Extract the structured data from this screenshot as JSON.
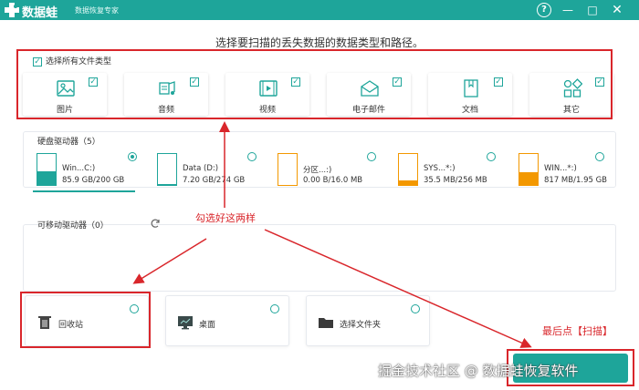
{
  "app": {
    "brand": "数据蛙",
    "subtitle": "数据恢复专家",
    "controls": {
      "help": "?",
      "minimize": "—",
      "maximize": "□",
      "close": "✕"
    }
  },
  "heading": "选择要扫描的丢失数据的数据类型和路径。",
  "select_all": {
    "label": "选择所有文件类型",
    "checked": true
  },
  "file_types": [
    {
      "label": "图片",
      "icon": "image-icon",
      "checked": true
    },
    {
      "label": "音频",
      "icon": "music-icon",
      "checked": true
    },
    {
      "label": "视频",
      "icon": "video-icon",
      "checked": true
    },
    {
      "label": "电子邮件",
      "icon": "email-icon",
      "checked": true
    },
    {
      "label": "文档",
      "icon": "document-icon",
      "checked": true
    },
    {
      "label": "其它",
      "icon": "other-icon",
      "checked": true
    }
  ],
  "hard_drives": {
    "title": "硬盘驱动器（5）",
    "items": [
      {
        "name": "Win...C:)",
        "size": "85.9 GB/200 GB",
        "used_fraction": 0.43,
        "selected": true
      },
      {
        "name": "Data (D:)",
        "size": "7.20 GB/274 GB",
        "used_fraction": 0.03,
        "selected": false
      },
      {
        "name": "分区...:)",
        "size": "0.00  B/16.0 MB",
        "used_fraction": 0.0,
        "selected": false
      },
      {
        "name": "SYS...*:)",
        "size": "35.5 MB/256 MB",
        "used_fraction": 0.14,
        "selected": false
      },
      {
        "name": "WIN...*:)",
        "size": "817 MB/1.95 GB",
        "used_fraction": 0.42,
        "selected": false
      }
    ]
  },
  "removable_drives": {
    "title": "可移动驱动器（0）"
  },
  "locations": [
    {
      "label": "回收站",
      "icon": "recycle-bin-icon"
    },
    {
      "label": "桌面",
      "icon": "desktop-icon"
    },
    {
      "label": "选择文件夹",
      "icon": "folder-icon"
    }
  ],
  "annotations": {
    "choose_both": "勾选好这两样",
    "finally_scan": "最后点【扫描】"
  },
  "watermark": "掘金技术社区 @ 数据蛙恢复软件",
  "colors": {
    "accent": "#1ea59a",
    "annotation": "#d9262b",
    "drive_warn": "#f39800"
  }
}
